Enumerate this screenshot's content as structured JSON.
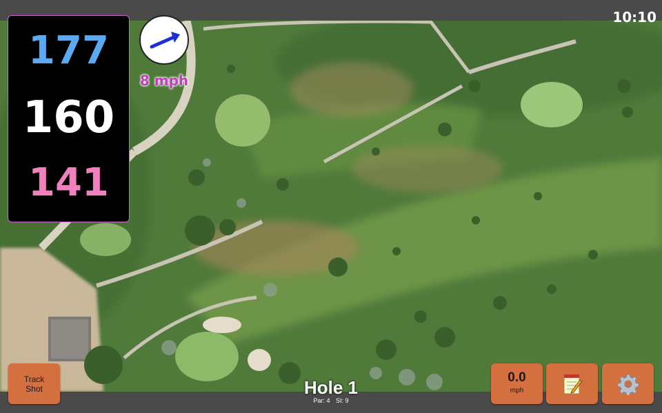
{
  "status": {
    "time": "10:10"
  },
  "distances": {
    "back": "177",
    "middle": "160",
    "front": "141"
  },
  "wind": {
    "speed": "8 mph",
    "icon": "wind-direction-arrow-icon"
  },
  "hole": {
    "title": "Hole 1",
    "par": "Par: 4",
    "stroke_index": "SI: 9"
  },
  "buttons": {
    "track_shot": "Track\nShot",
    "speed_value": "0.0",
    "speed_unit": "mph",
    "notes_icon": "notepad-icon",
    "settings_icon": "gear-icon"
  },
  "colors": {
    "back_distance": "#5aa9f2",
    "middle_distance": "#ffffff",
    "front_distance": "#f27fbe",
    "button": "#d4703f",
    "wind_text": "#c040c0"
  }
}
